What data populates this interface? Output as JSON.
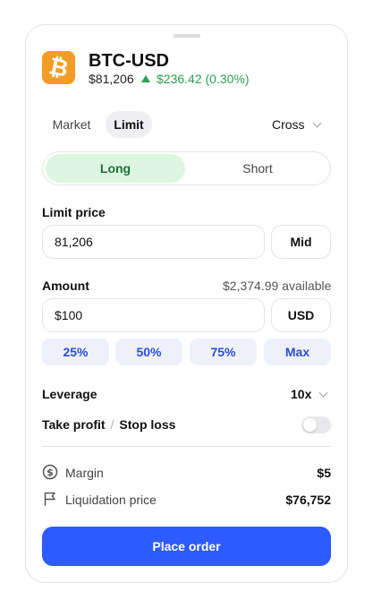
{
  "ticker": {
    "symbol": "BTC-USD",
    "price": "$81,206",
    "change": "$236.42 (0.30%)",
    "direction": "up",
    "coin_icon": "bitcoin-icon",
    "coin_glyph": "₿"
  },
  "order_type_tabs": [
    {
      "label": "Market",
      "selected": false
    },
    {
      "label": "Limit",
      "selected": true
    }
  ],
  "margin_mode": {
    "label": "Cross"
  },
  "side": [
    {
      "label": "Long",
      "selected": true
    },
    {
      "label": "Short",
      "selected": false
    }
  ],
  "limit_price": {
    "label": "Limit price",
    "value": "81,206",
    "mid_button": "Mid"
  },
  "amount": {
    "label": "Amount",
    "available": "$2,374.99 available",
    "value": "$100",
    "currency_button": "USD",
    "presets": [
      "25%",
      "50%",
      "75%",
      "Max"
    ]
  },
  "leverage": {
    "label": "Leverage",
    "value": "10x"
  },
  "tp_sl": {
    "take_profit": "Take profit",
    "separator": "/",
    "stop_loss": "Stop loss",
    "enabled": false
  },
  "summary": {
    "margin": {
      "label": "Margin",
      "value": "$5",
      "icon": "dollar-circle-icon"
    },
    "liquidation": {
      "label": "Liquidation price",
      "value": "$76,752",
      "icon": "flag-icon"
    }
  },
  "place_order": "Place order",
  "colors": {
    "accent": "#2d5bff",
    "positive": "#2c9f52",
    "long_bg": "#dcf6e1",
    "preset_bg": "#eef1fc",
    "coin": "#f39c26"
  }
}
